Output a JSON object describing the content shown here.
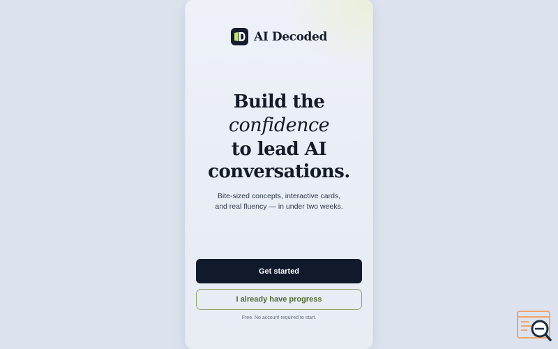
{
  "brand": {
    "name": "AI Decoded"
  },
  "hero": {
    "headline_lines": [
      "Build the",
      "confidence",
      "to lead AI",
      "conversations."
    ],
    "subcopy_lines": [
      "Bite-sized concepts, interactive cards,",
      "and real fluency — in under two weeks."
    ]
  },
  "actions": {
    "primary_label": "Get started",
    "secondary_label": "I already have progress",
    "fineprint": "Free. No account required to start."
  },
  "colors": {
    "page_background": "#dde3ee",
    "primary_button": "#111a2b",
    "secondary_border": "#8ea56f",
    "secondary_text": "#4e6a2e",
    "brand_mark": "#141d2e",
    "brand_accent": "#c6df7a",
    "widget_accent": "#f0a46b"
  },
  "icons": {
    "brand_mark": "book-d-logo-icon",
    "corner_widget": "search-document-icon"
  }
}
